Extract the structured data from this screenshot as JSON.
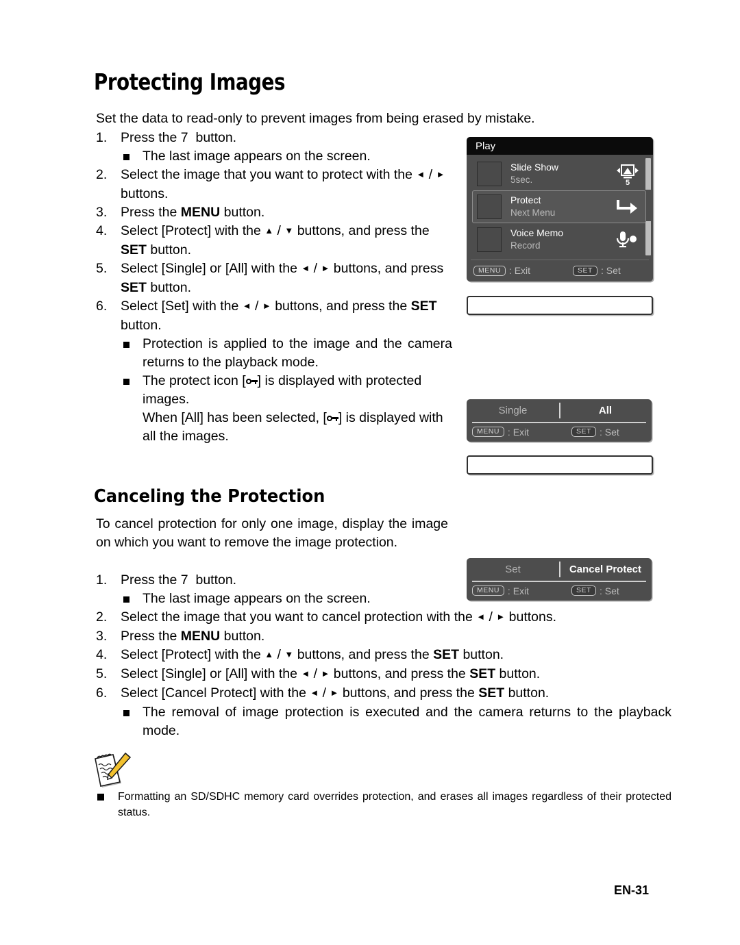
{
  "page": {
    "title": "Protecting Images",
    "intro": "Set the data to read-only to prevent images from being erased by mistake.",
    "footer_page": "EN-31"
  },
  "protect_steps": [
    {
      "num": "1.",
      "text": "Press the 7  button.",
      "sub": [
        "The last image appears on the screen."
      ]
    },
    {
      "num": "2.",
      "text": "Select the image that you want to protect with the ◄ / ► buttons."
    },
    {
      "num": "3.",
      "text": "Press the MENU button."
    },
    {
      "num": "4.",
      "text": "Select [Protect] with the ▲ / ▼ buttons, and press the SET button."
    },
    {
      "num": "5.",
      "text": "Select [Single] or [All] with the ◄ / ► buttons, and press SET button."
    },
    {
      "num": "6.",
      "text": "Select [Set] with the ◄ / ► buttons, and press the SET button.",
      "sub": [
        "Protection is applied to the image and the camera returns to the playback mode.",
        "The protect icon [key] is displayed with protected images.",
        "When [All] has been selected, [key] is displayed with all the images."
      ]
    }
  ],
  "cancel_section": {
    "heading": "Canceling the Protection",
    "intro": "To cancel protection for only one image, display the image on which you want to remove the image protection.",
    "steps": [
      {
        "num": "1.",
        "text": "Press the 7  button.",
        "sub": [
          "The last image appears on the screen."
        ]
      },
      {
        "num": "2.",
        "text": "Select the image that you want to cancel protection with the ◄ / ► buttons."
      },
      {
        "num": "3.",
        "text": "Press the MENU button."
      },
      {
        "num": "4.",
        "text": "Select [Protect] with the ▲ / ▼ buttons, and press the SET button."
      },
      {
        "num": "5.",
        "text": "Select [Single] or [All] with the ◄ / ► buttons, and press the SET button."
      },
      {
        "num": "6.",
        "text": "Select [Cancel Protect] with the ◄ / ► buttons, and press the SET button.",
        "sub": [
          "The removal of image protection is executed and the camera returns to the playback mode."
        ]
      }
    ]
  },
  "note": {
    "icon": "notepad-pencil-icon",
    "items": [
      "Formatting an SD/SDHC memory card overrides protection, and erases all images regardless of their protected status."
    ]
  },
  "play_menu": {
    "title": "Play",
    "rows": [
      {
        "label": "Slide Show",
        "value": "5sec.",
        "icon": "slideshow-icon",
        "selected": false
      },
      {
        "label": "Protect",
        "value": "Next Menu",
        "icon": "next-menu-arrow-icon",
        "selected": true
      },
      {
        "label": "Voice Memo",
        "value": "Record",
        "icon": "microphone-record-icon",
        "selected": false
      }
    ],
    "hints": [
      {
        "key": "MENU",
        "action": ": Exit"
      },
      {
        "key": "SET",
        "action": ": Set"
      }
    ]
  },
  "option_panels": [
    {
      "name": "single-all",
      "left": {
        "label": "Single",
        "active": false
      },
      "right": {
        "label": "All",
        "active": true
      },
      "hints": [
        {
          "key": "MENU",
          "action": ": Exit"
        },
        {
          "key": "SET",
          "action": ": Set"
        }
      ]
    },
    {
      "name": "set-cancel-protect",
      "left": {
        "label": "Set",
        "active": false
      },
      "right": {
        "label": "Cancel Protect",
        "active": true
      },
      "hints": [
        {
          "key": "MENU",
          "action": ": Exit"
        },
        {
          "key": "SET",
          "action": ": Set"
        }
      ]
    }
  ],
  "colors": {
    "panel_bg": "#4d4d4d",
    "panel_title_bg": "#0b0b0b",
    "panel_selected_bg": "#565656",
    "muted_text": "#b9b9b9",
    "note_pencil": "#f2c12e"
  }
}
